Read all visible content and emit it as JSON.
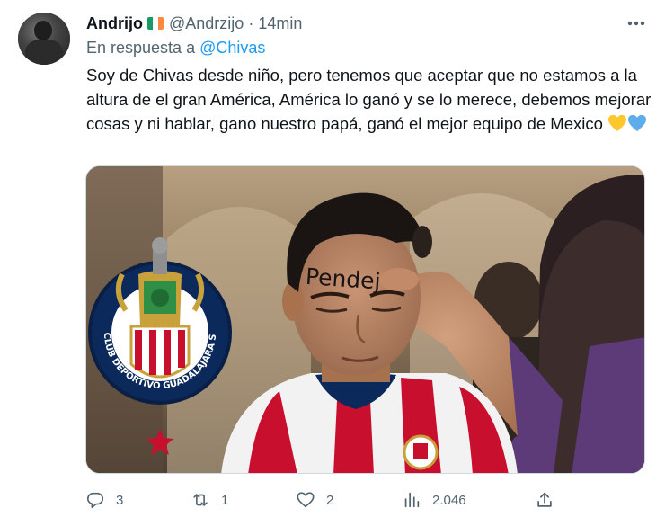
{
  "tweet": {
    "author_name": "Andrijo",
    "author_handle": "@Andrzijo",
    "separator": "·",
    "timestamp": "14min",
    "reply_prefix": "En respuesta a",
    "reply_mention": "@Chivas",
    "body_text": "Soy de Chivas desde niño, pero tenemos que aceptar que no estamos a la altura de el gran América, América lo ganó y se lo merece, debemos mejorar cosas y ni hablar, gano nuestro papá, ganó el mejor equipo de Mexico",
    "body_emojis": [
      "yellow-heart-emoji",
      "blue-heart-emoji"
    ],
    "flag_colors": [
      "#169b62",
      "#ffffff",
      "#ff883e"
    ],
    "accent_color": "#1d9bf0",
    "media": {
      "forehead_text": "Pendej",
      "crest_text": "CLUB DEPORTIVO GUADALAJARA S.A. DE C.V.",
      "colors": {
        "chivas_red": "#c8102e",
        "chivas_blue": "#0b2a5b",
        "crest_gold": "#c9a13b"
      }
    },
    "actions": {
      "replies": "3",
      "retweets": "1",
      "likes": "2",
      "views": "2.046"
    },
    "icons": [
      "more-icon",
      "reply-icon",
      "retweet-icon",
      "like-icon",
      "views-icon",
      "share-icon"
    ]
  }
}
